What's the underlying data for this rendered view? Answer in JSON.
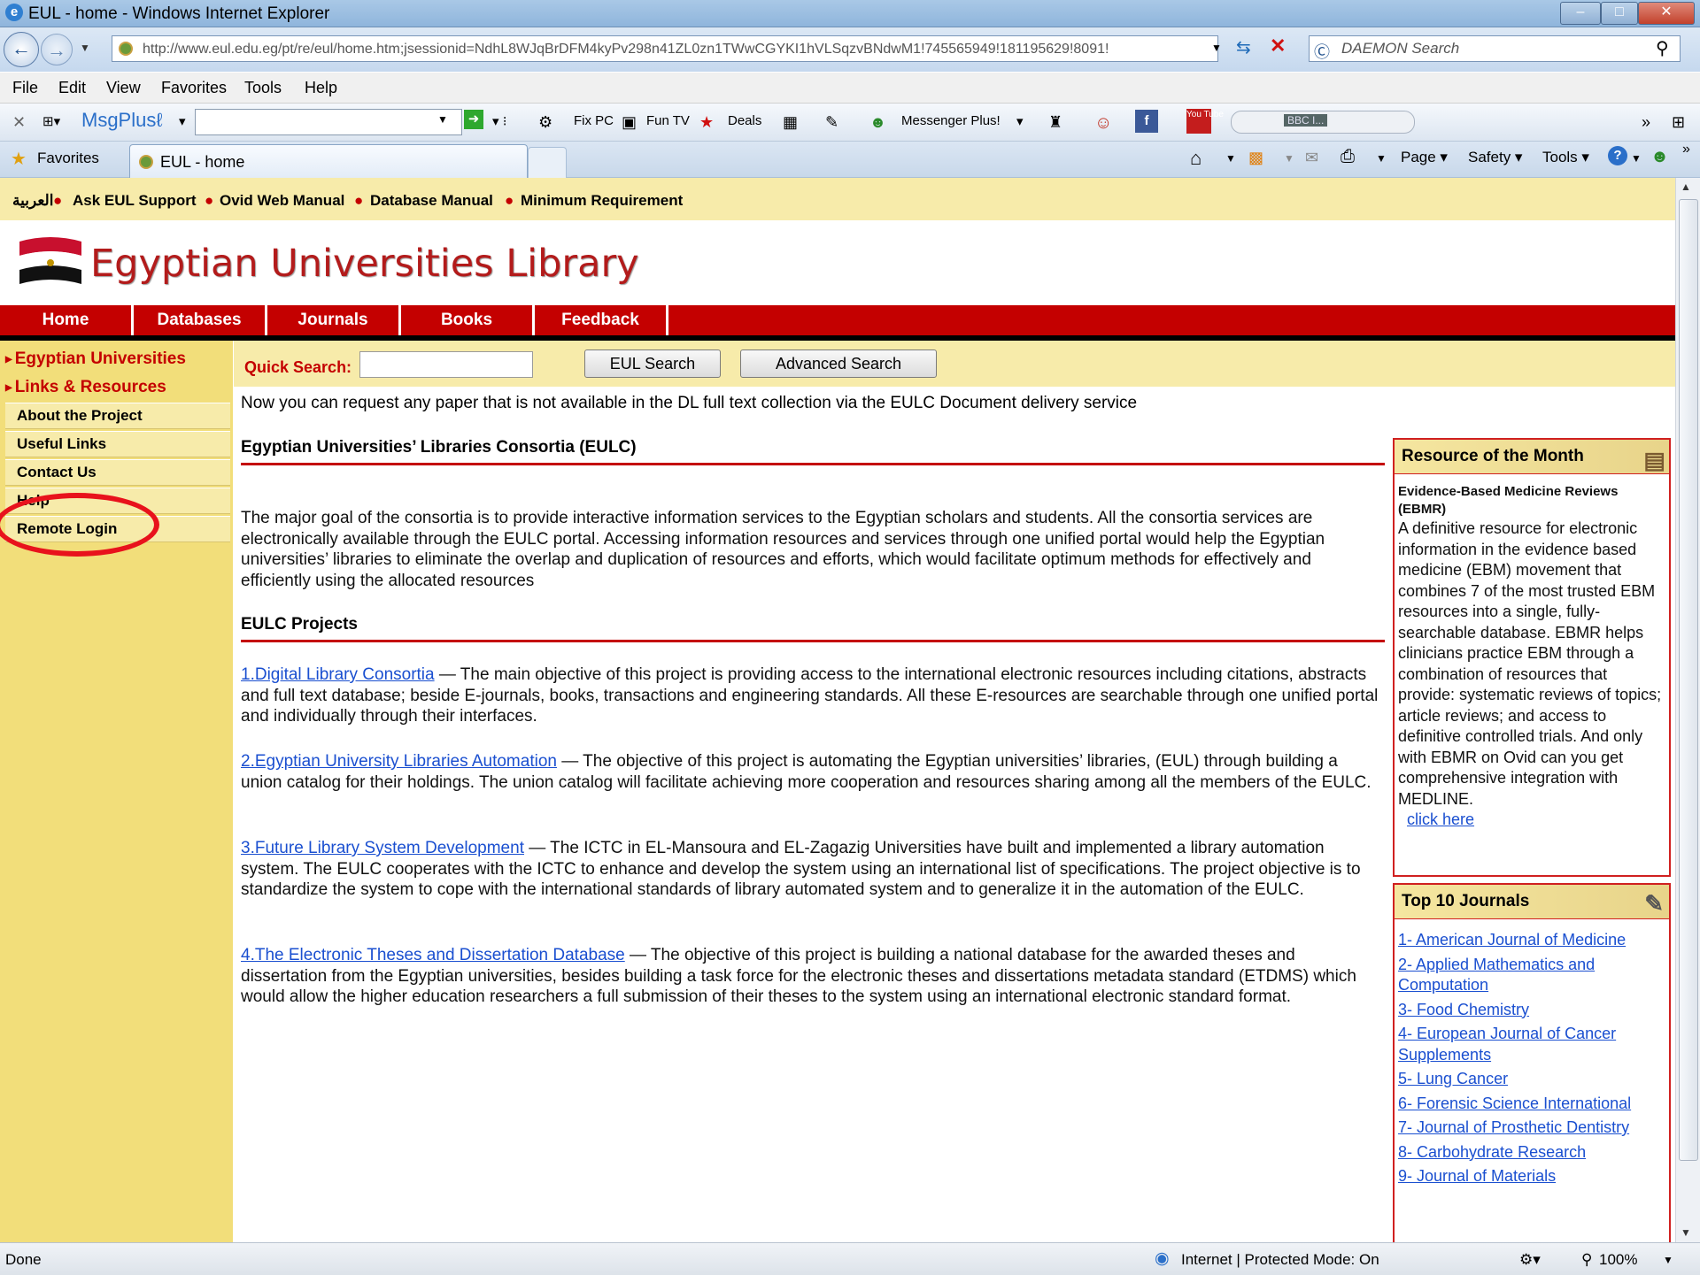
{
  "window": {
    "title": "EUL - home - Windows Internet Explorer",
    "minimize": "–",
    "maximize": "□",
    "close": "✕"
  },
  "address": {
    "url": "http://www.eul.edu.eg/pt/re/eul/home.htm;jsessionid=NdhL8WJqBrDFM4kyPv298n41ZL0zn1TWwCGYKI1hVLSqzvBNdwM1!745565949!181195629!8091!",
    "search_placeholder": "DAEMON Search"
  },
  "menu": [
    "File",
    "Edit",
    "View",
    "Favorites",
    "Tools",
    "Help"
  ],
  "toolbar": {
    "msgplus": "MsgPlusℓ",
    "fixpc": "Fix PC",
    "funtv": "Fun TV",
    "deals": "Deals",
    "messenger": "Messenger Plus!",
    "bbc": "BBC I..."
  },
  "tabs": {
    "favorites": "Favorites",
    "active_tab": "EUL - home"
  },
  "commands": {
    "page": "Page ▾",
    "safety": "Safety ▾",
    "tools": "Tools ▾"
  },
  "top_links": {
    "arabic": "العربية",
    "support": "Ask EUL Support",
    "ovid": "Ovid Web Manual",
    "database": "Database Manual",
    "minreq": "Minimum Requirement"
  },
  "logo_text": "Egyptian Universities Library",
  "nav": [
    "Home",
    "Databases",
    "Journals",
    "Books",
    "Feedback"
  ],
  "sidebar": {
    "heads": [
      "Egyptian Universities",
      "Links & Resources"
    ],
    "items": [
      "About the Project",
      "Useful Links",
      "Contact Us",
      "Help",
      "Remote Login"
    ]
  },
  "quick_search": {
    "label": "Quick Search:",
    "eul_search": "EUL Search",
    "advanced": "Advanced Search"
  },
  "notice": "Now you can request any paper that is not available in the DL full text collection via the EULC Document delivery service",
  "consortia": {
    "heading": "Egyptian Universities’ Libraries Consortia (EULC)",
    "text": "The major goal of the consortia is to provide interactive information services to the Egyptian scholars and students. All the consortia services are electronically available through the EULC portal. Accessing information resources and services through one unified portal would help the Egyptian universities’ libraries to eliminate the overlap and duplication of resources and efforts, which would facilitate optimum methods for effectively and efficiently using the allocated resources"
  },
  "projects": {
    "heading": "EULC Projects",
    "items": [
      {
        "link": "1.Digital Library Consortia",
        "text": " — The main objective of this project is providing access to the international electronic resources including citations, abstracts and full text database; beside E-journals, books, transactions and engineering standards. All these E-resources are searchable through one unified portal and individually through their interfaces."
      },
      {
        "link": "2.Egyptian University Libraries Automation",
        "text": " — The objective of this project is automating the Egyptian universities’ libraries, (EUL) through building a union catalog for their holdings. The union catalog will facilitate achieving more cooperation and resources sharing among all the members of the EULC."
      },
      {
        "link": "3.Future Library System Development",
        "text": " — The ICTC in EL-Mansoura and EL-Zagazig Universities have built and implemented a library automation system. The EULC cooperates with the ICTC to enhance and develop the system using an international list of specifications. The project objective is to standardize the system to cope with the international standards of library automated system and to generalize it in the automation of the EULC."
      },
      {
        "link": "4.The Electronic Theses and Dissertation Database",
        "text": " — The objective of this project is building a national database for the awarded theses and dissertation from the Egyptian universities, besides building a task force for the electronic theses and dissertations metadata standard (ETDMS) which would allow the higher education researchers a full submission of their theses to the system using an international electronic standard format."
      }
    ]
  },
  "resource_month": {
    "heading": "Resource of the Month",
    "title": "Evidence-Based Medicine Reviews (EBMR)",
    "text": "A definitive resource for electronic information in the evidence based medicine (EBM) movement that combines 7 of the most trusted EBM resources into a single, fully-searchable database. EBMR helps clinicians practice EBM through a combination of resources that provide: systematic reviews of topics; article reviews; and access to definitive controlled trials. And only with EBMR on Ovid can you get comprehensive integration with MEDLINE.",
    "link": "click here"
  },
  "top_journals": {
    "heading": "Top 10 Journals",
    "items": [
      "1- American Journal of Medicine",
      "2- Applied Mathematics and Computation",
      "3- Food Chemistry",
      "4- European Journal of Cancer Supplements",
      "5- Lung Cancer",
      "6- Forensic Science International",
      "7- Journal of Prosthetic Dentistry",
      "8- Carbohydrate Research",
      "9- Journal of Materials"
    ]
  },
  "status": {
    "left": "Done",
    "zone": "Internet | Protected Mode: On",
    "zoom": "100%"
  }
}
